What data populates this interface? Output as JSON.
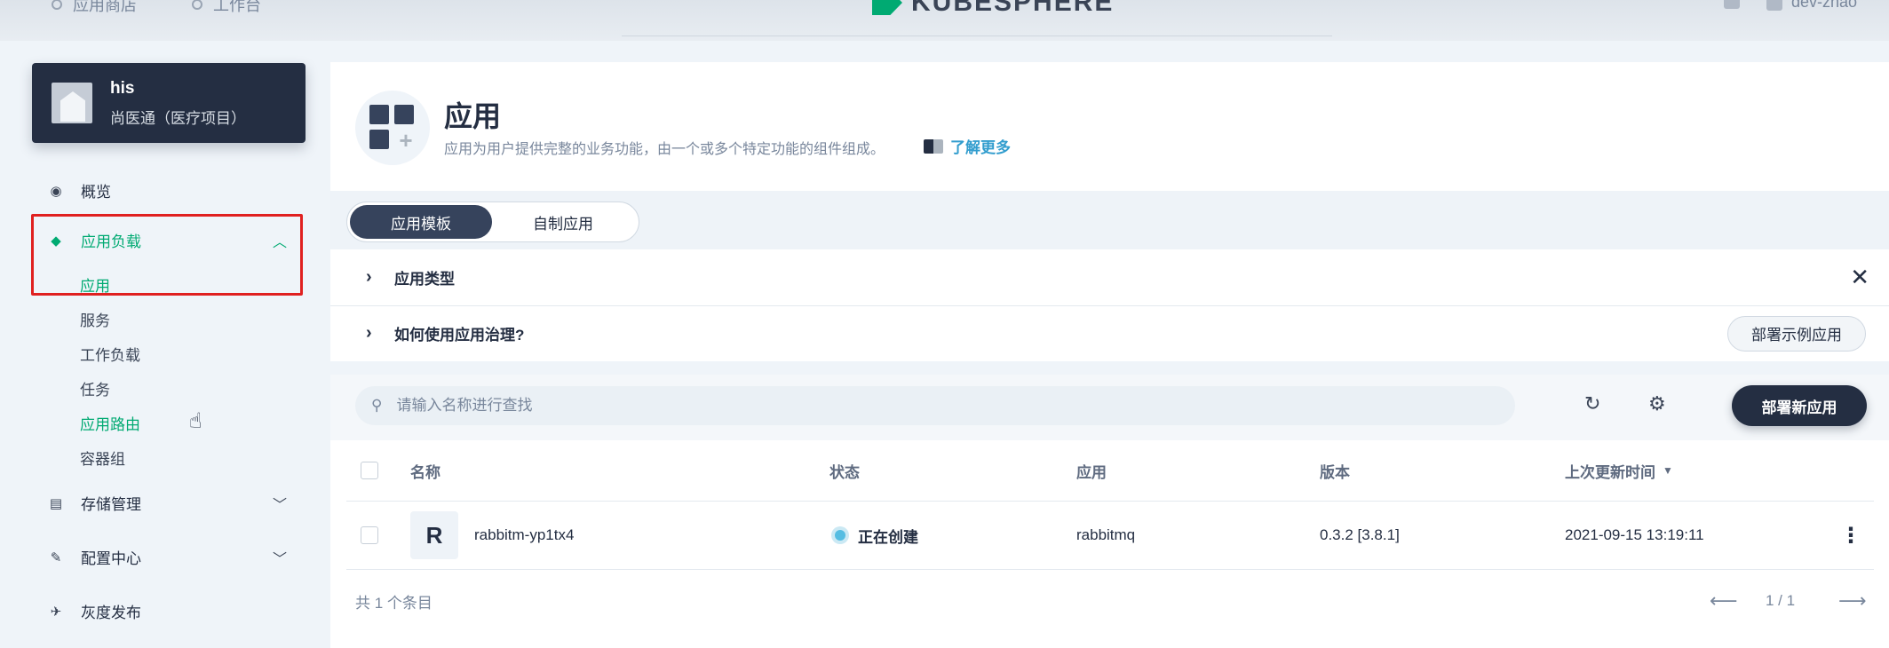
{
  "topbar": {
    "nav_items": [
      "应用商店",
      "工作台"
    ],
    "brand": "KUBESPHERE",
    "user_name": "dev-zhao"
  },
  "workspace": {
    "name": "his",
    "description": "尚医通（医疗项目）"
  },
  "sidebar": {
    "items": [
      {
        "label": "概览",
        "icon": "dashboard-icon"
      },
      {
        "label": "应用负载",
        "icon": "appcenter-icon",
        "expanded": true
      },
      {
        "label": "存储管理",
        "icon": "storage-icon"
      },
      {
        "label": "配置中心",
        "icon": "wrench-icon"
      },
      {
        "label": "灰度发布",
        "icon": "bird-icon"
      }
    ],
    "sub_items": [
      "应用",
      "服务",
      "工作负载",
      "任务",
      "应用路由",
      "容器组"
    ]
  },
  "header": {
    "title": "应用",
    "description": "应用为用户提供完整的业务功能，由一个或多个特定功能的组件组成。",
    "learn_more": "了解更多"
  },
  "tabs": [
    "应用模板",
    "自制应用"
  ],
  "info": {
    "app_types": "应用类型",
    "how_to_use": "如何使用应用治理?",
    "sample_button": "部署示例应用"
  },
  "toolbar": {
    "search_placeholder": "请输入名称进行查找",
    "deploy_button": "部署新应用"
  },
  "table": {
    "columns": [
      "名称",
      "状态",
      "应用",
      "版本",
      "上次更新时间"
    ],
    "rows": [
      {
        "avatar": "R",
        "name": "rabbitm-yp1tx4",
        "status": "正在创建",
        "app": "rabbitmq",
        "version": "0.3.2 [3.8.1]",
        "updated": "2021-09-15 13:19:11"
      }
    ]
  },
  "footer": {
    "total": "共 1 个条目",
    "page": "1 / 1"
  }
}
